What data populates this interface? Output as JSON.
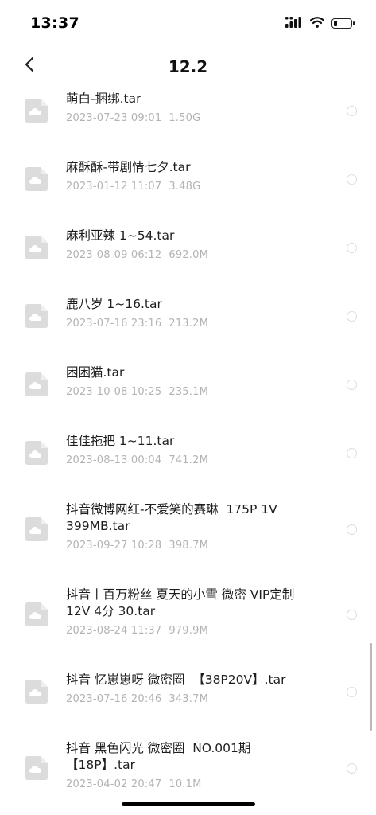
{
  "status_bar": {
    "time": "13:37",
    "icons": [
      "cellular-signal-icon",
      "wifi-icon",
      "battery-icon"
    ],
    "battery_level": 0.2
  },
  "header": {
    "back_icon": "chevron-left-icon",
    "title": "12.2"
  },
  "colors": {
    "icon_fill": "#dcdcdc",
    "meta_text": "#b3b3b3",
    "radio_border": "#dcdcdc"
  },
  "files": [
    {
      "name": "萌白-捆绑.tar",
      "date": "2023-07-23 09:01",
      "size": "1.50G"
    },
    {
      "name": "麻酥酥-带剧情七夕.tar",
      "date": "2023-01-12 11:07",
      "size": "3.48G"
    },
    {
      "name": "麻利亚辣 1~54.tar",
      "date": "2023-08-09 06:12",
      "size": "692.0M"
    },
    {
      "name": "鹿八岁 1~16.tar",
      "date": "2023-07-16 23:16",
      "size": "213.2M"
    },
    {
      "name": "困困猫.tar",
      "date": "2023-10-08 10:25",
      "size": "235.1M"
    },
    {
      "name": "佳佳拖把 1~11.tar",
      "date": "2023-08-13 00:04",
      "size": "741.2M"
    },
    {
      "name": "抖音微博网红-不爱笑的赛琳  175P 1V\n399MB.tar",
      "date": "2023-09-27 10:28",
      "size": "398.7M"
    },
    {
      "name": "抖音丨百万粉丝 夏天的小雪 微密 VIP定制\n12V 4分 30.tar",
      "date": "2023-08-24 11:37",
      "size": "979.9M"
    },
    {
      "name": "抖音 忆崽崽呀 微密圈  【38P20V】.tar",
      "date": "2023-07-16 20:46",
      "size": "343.7M"
    },
    {
      "name": "抖音 黑色闪光 微密圈  NO.001期\n【18P】.tar",
      "date": "2023-04-02 20:47",
      "size": "10.1M"
    }
  ]
}
